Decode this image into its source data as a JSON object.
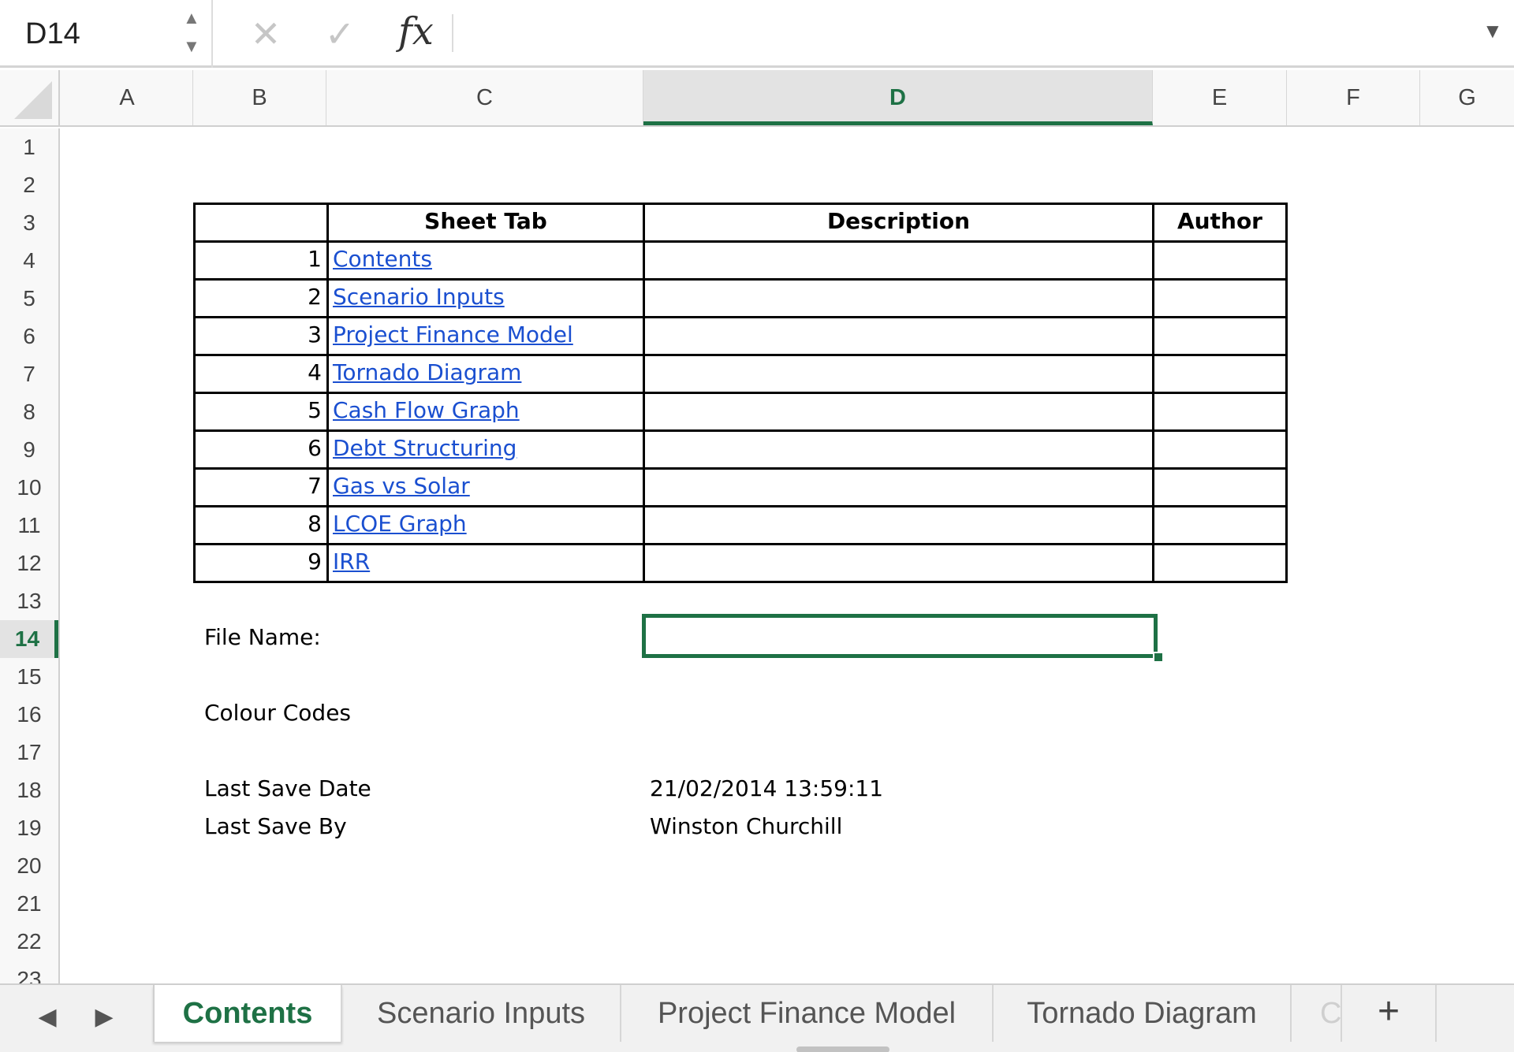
{
  "formula_bar": {
    "name_box": "D14",
    "cancel_icon": "✕",
    "enter_icon": "✓",
    "fx_label": "fx",
    "formula_value": ""
  },
  "columns": [
    "A",
    "B",
    "C",
    "D",
    "E",
    "F",
    "G"
  ],
  "active_column": "D",
  "rows": [
    "1",
    "2",
    "3",
    "4",
    "5",
    "6",
    "7",
    "8",
    "9",
    "10",
    "11",
    "12",
    "13",
    "14",
    "15",
    "16",
    "17",
    "18",
    "19",
    "20",
    "21",
    "22",
    "23"
  ],
  "active_row": "14",
  "contents_table": {
    "headers": {
      "sheet_tab": "Sheet Tab",
      "description": "Description",
      "author": "Author"
    },
    "entries": [
      {
        "index": "1",
        "sheet": "Contents",
        "description": "",
        "author": ""
      },
      {
        "index": "2",
        "sheet": "Scenario Inputs",
        "description": "",
        "author": ""
      },
      {
        "index": "3",
        "sheet": "Project Finance Model",
        "description": "",
        "author": ""
      },
      {
        "index": "4",
        "sheet": "Tornado Diagram",
        "description": "",
        "author": ""
      },
      {
        "index": "5",
        "sheet": "Cash Flow Graph",
        "description": "",
        "author": ""
      },
      {
        "index": "6",
        "sheet": "Debt Structuring",
        "description": "",
        "author": ""
      },
      {
        "index": "7",
        "sheet": "Gas vs Solar",
        "description": "",
        "author": ""
      },
      {
        "index": "8",
        "sheet": "LCOE Graph",
        "description": "",
        "author": ""
      },
      {
        "index": "9",
        "sheet": "IRR",
        "description": "",
        "author": ""
      }
    ]
  },
  "fields": {
    "file_name_label": "File Name:",
    "file_name_value": "",
    "colour_codes_label": "Colour Codes",
    "last_save_date_label": "Last Save Date",
    "last_save_date_value": "21/02/2014 13:59:11",
    "last_save_by_label": "Last Save By",
    "last_save_by_value": "Winston Churchill"
  },
  "sheet_tabs": {
    "prev_icon": "◀",
    "next_icon": "▶",
    "tabs": [
      "Contents",
      "Scenario Inputs",
      "Project Finance Model",
      "Tornado Diagram",
      "C"
    ],
    "active": "Contents",
    "add_label": "+"
  },
  "colors": {
    "accent_green": "#1e7145",
    "hyperlink_blue": "#1a4fd0",
    "header_bg": "#f8f8f8"
  }
}
